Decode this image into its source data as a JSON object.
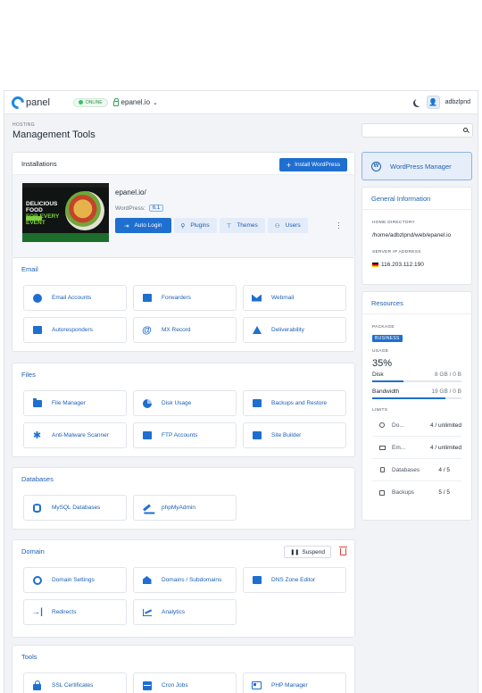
{
  "topbar": {
    "logo_text": "panel",
    "status": "ONLINE",
    "domain": "epanel.io",
    "username": "adbzlpnd"
  },
  "breadcrumb": "HOSTING",
  "page_title": "Management Tools",
  "installations": {
    "title": "Installations",
    "install_button": "Install WordPress",
    "site_name": "epanel.io/",
    "wp_label": "WordPress:",
    "wp_version": "6.1",
    "thumb_headline_1": "DELICIOUS FOOD",
    "thumb_headline_2": "FOR EVERY EVENT",
    "actions": {
      "auto_login": "Auto Login",
      "plugins": "Plugins",
      "themes": "Themes",
      "users": "Users"
    }
  },
  "sections": {
    "email": {
      "title": "Email",
      "tiles": [
        "Email Accounts",
        "Forwarders",
        "Webmail",
        "Autoresponders",
        "MX Record",
        "Deliverability"
      ]
    },
    "files": {
      "title": "Files",
      "tiles": [
        "File Manager",
        "Disk Usage",
        "Backups and Restore",
        "Anti-Malware Scanner",
        "FTP Accounts",
        "Site Builder"
      ]
    },
    "databases": {
      "title": "Databases",
      "tiles": [
        "MySQL Databases",
        "phpMyAdmin"
      ]
    },
    "domain": {
      "title": "Domain",
      "suspend": "Suspend",
      "tiles": [
        "Domain Settings",
        "Domains / Subdomains",
        "DNS Zone Editor",
        "Redirects",
        "Analytics"
      ]
    },
    "tools": {
      "title": "Tools",
      "tiles": [
        "SSL Certificates",
        "Cron Jobs",
        "PHP Manager"
      ]
    }
  },
  "sidebar": {
    "wp_manager": "WordPress Manager",
    "general": {
      "title": "General Information",
      "home_label": "HOME DIRECTORY",
      "home_value": "/home/adbzlpnd/web/epanel.io",
      "ip_label": "SERVER IP ADDRESS",
      "ip_value": "116.203.112.190"
    },
    "resources": {
      "title": "Resources",
      "package_label": "PACKAGE",
      "package_value": "BUSINESS",
      "usage_label": "USAGE",
      "usage_pct": "35%",
      "disk_label": "Disk",
      "disk_value": "8 GB / 0 B",
      "disk_fill": 0.35,
      "bw_label": "Bandwidth",
      "bw_value": "19 GB / 0 B",
      "bw_fill": 0.82,
      "limits_label": "LIMITS",
      "limits": [
        {
          "name": "Do...",
          "value": "4 / unlimited"
        },
        {
          "name": "Em...",
          "value": "4 / unlimited"
        },
        {
          "name": "Databases",
          "value": "4 / 5"
        },
        {
          "name": "Backups",
          "value": "5 / 5"
        }
      ]
    }
  }
}
